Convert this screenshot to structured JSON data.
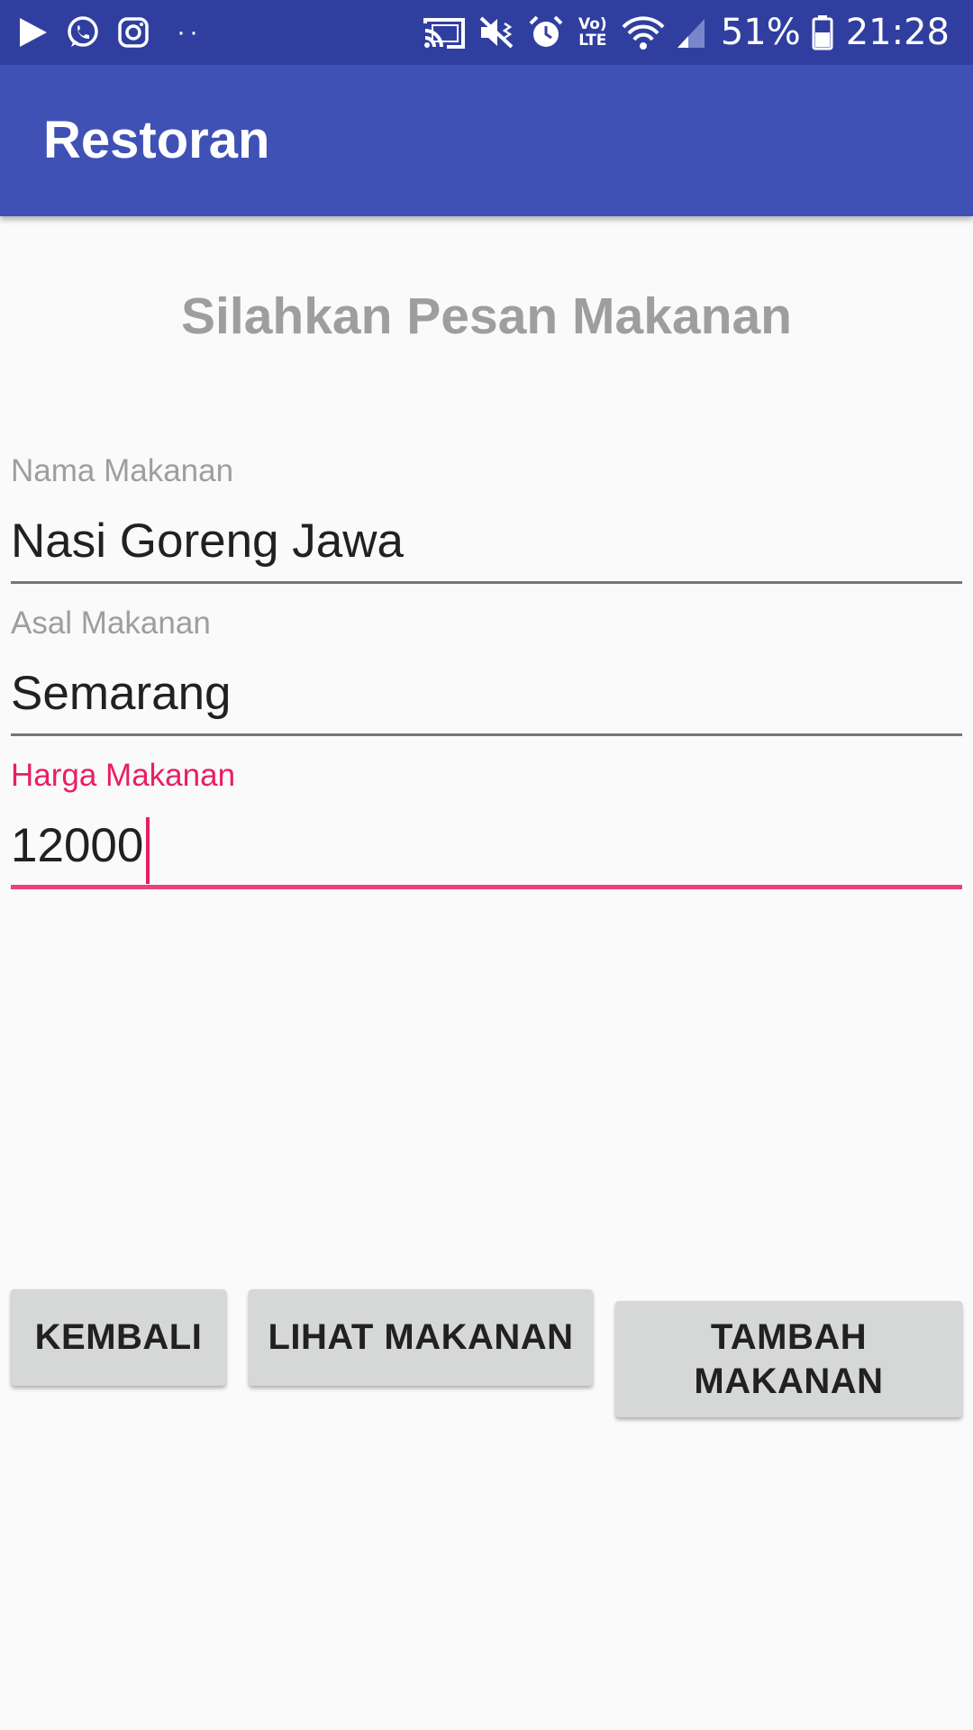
{
  "status_bar": {
    "left_icons": [
      "play-store-icon",
      "whatsapp-icon",
      "instagram-icon",
      "more-notifications-icon"
    ],
    "right_icons": [
      "cast-icon",
      "mute-icon",
      "alarm-icon",
      "volte-icon",
      "wifi-icon",
      "signal-icon",
      "battery-icon"
    ],
    "volte_label": "Vo) LTE",
    "more_dots": "··",
    "battery_percent": "51%",
    "time": "21:28"
  },
  "app_bar": {
    "title": "Restoran",
    "color": "#3f51b5",
    "status_color": "#303f9f"
  },
  "main": {
    "heading": "Silahkan Pesan Makanan",
    "fields": [
      {
        "label": "Nama Makanan",
        "value": "Nasi Goreng Jawa",
        "focused": false
      },
      {
        "label": "Asal Makanan",
        "value": "Semarang",
        "focused": false
      },
      {
        "label": "Harga Makanan",
        "value": "12000",
        "focused": true
      }
    ],
    "accent_color": "#e91e63"
  },
  "buttons": {
    "back_label": "KEMBALI",
    "view_label": "LIHAT MAKANAN",
    "add_label": "TAMBAH MAKANAN"
  }
}
